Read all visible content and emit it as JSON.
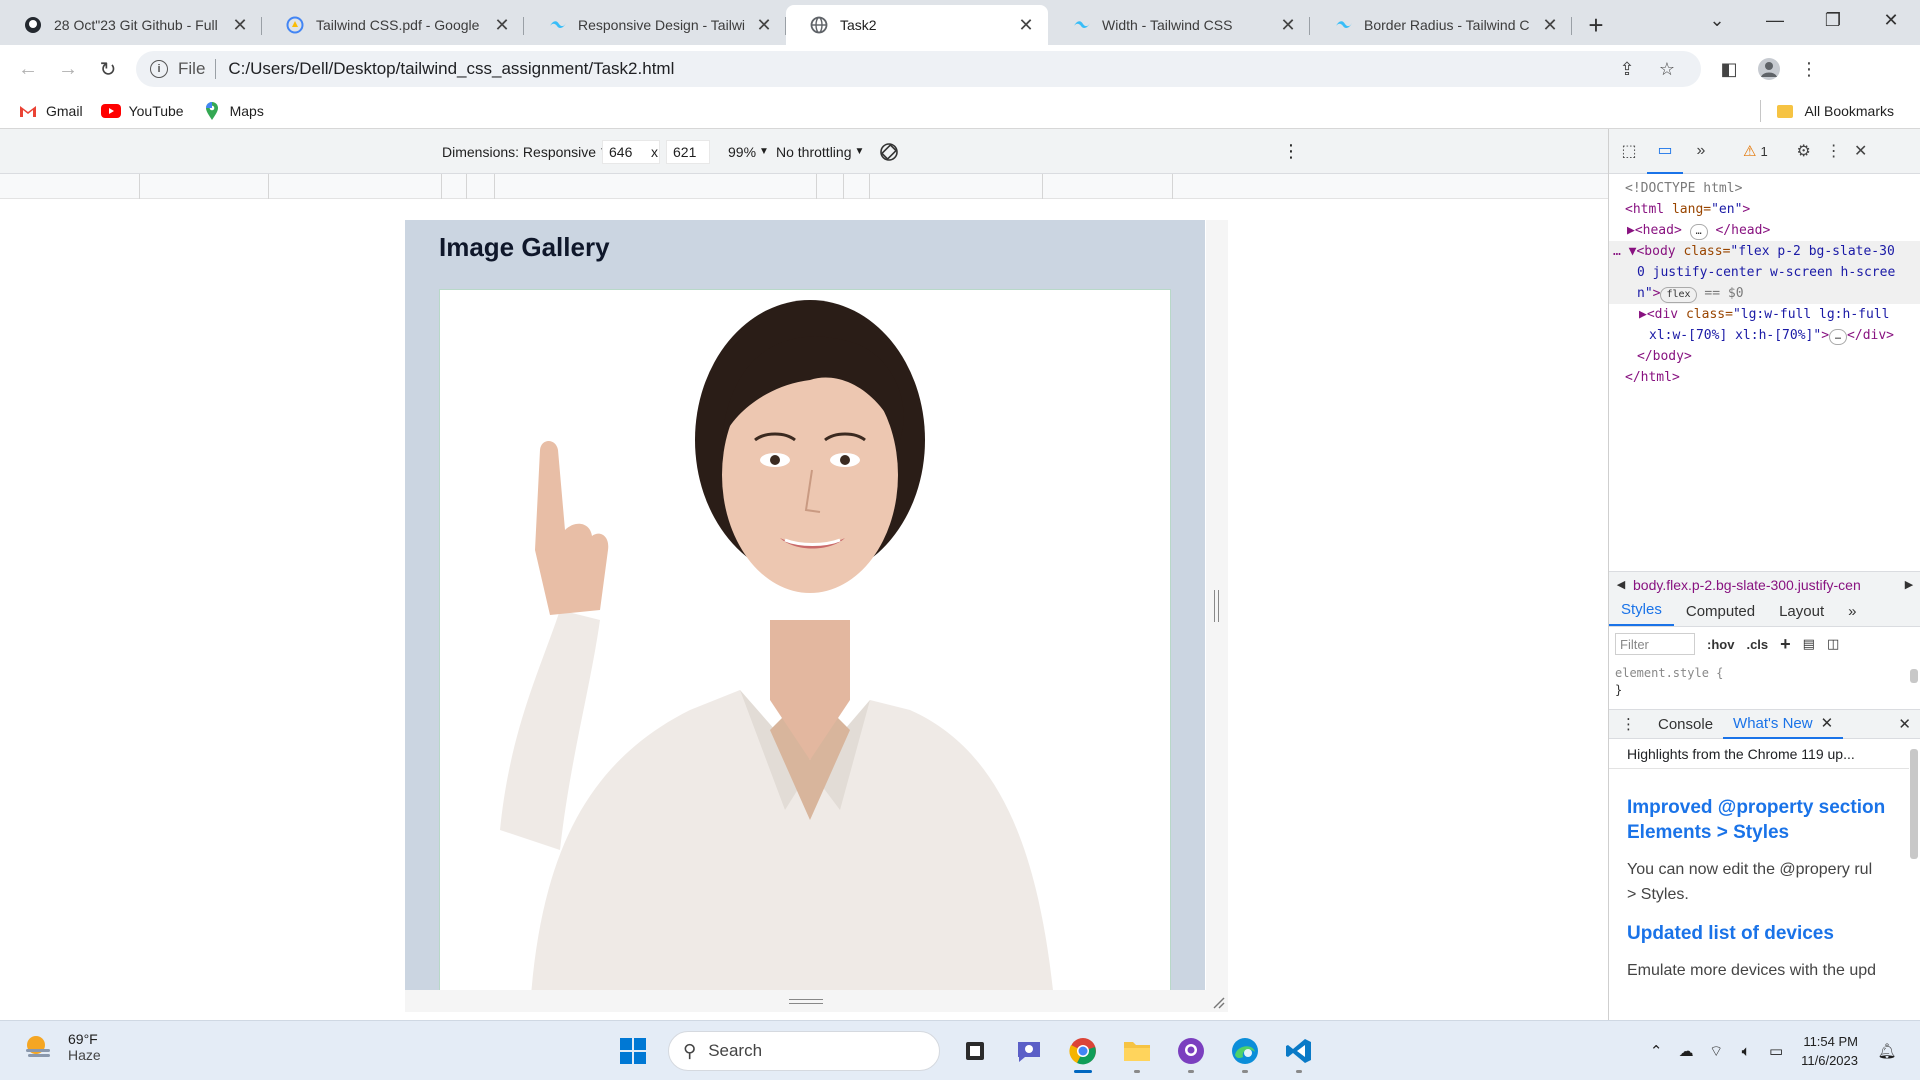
{
  "browser": {
    "tabs": [
      {
        "title": "28 Oct\"23 Git Github - Full",
        "icon": "github-icon",
        "active": false
      },
      {
        "title": "Tailwind CSS.pdf - Google",
        "icon": "google-drive-icon",
        "active": false
      },
      {
        "title": "Responsive Design - Tailwi",
        "icon": "tailwind-icon",
        "active": false
      },
      {
        "title": "Task2",
        "icon": "globe-icon",
        "active": true
      },
      {
        "title": "Width - Tailwind CSS",
        "icon": "tailwind-icon",
        "active": false
      },
      {
        "title": "Border Radius - Tailwind C",
        "icon": "tailwind-icon",
        "active": false
      }
    ],
    "address": {
      "scheme": "File",
      "url": "C:/Users/Dell/Desktop/tailwind_css_assignment/Task2.html"
    },
    "bookmarks": [
      {
        "label": "Gmail",
        "icon": "gmail-icon"
      },
      {
        "label": "YouTube",
        "icon": "youtube-icon"
      },
      {
        "label": "Maps",
        "icon": "maps-icon"
      }
    ],
    "all_bookmarks": "All Bookmarks"
  },
  "device_toolbar": {
    "dimensions_label": "Dimensions: Responsive",
    "width": "646",
    "times": "x",
    "height": "621",
    "zoom": "99%",
    "throttling": "No throttling"
  },
  "page": {
    "title": "Image Gallery",
    "bg_color": "#cbd5e1"
  },
  "devtools": {
    "warnings": "1",
    "elements": {
      "doctype": "<!DOCTYPE html>",
      "html_open_tag": "<html",
      "html_lang_attr": " lang=",
      "html_lang_val": "\"en\"",
      "head_line": "<head>",
      "head_close": "</head>",
      "body_tag": "<body",
      "body_class_attr": " class=",
      "body_class_line1": "\"flex p-2 bg-slate-30",
      "body_class_line2": "0 justify-center w-screen h-scree",
      "body_class_line3": "n\"",
      "flex_badge": "flex",
      "dollar0": "== $0",
      "div_tag": "<div",
      "div_class_attr": " class=",
      "div_class_line1": "\"lg:w-full lg:h-full",
      "div_class_line2": "xl:w-[70%] xl:h-[70%]\"",
      "div_close": "</div>",
      "body_close": "</body>",
      "html_close": "</html>"
    },
    "breadcrumb": "body.flex.p-2.bg-slate-300.justify-cen",
    "style_tabs": [
      "Styles",
      "Computed",
      "Layout"
    ],
    "filter_placeholder": "Filter",
    "hov": ":hov",
    "cls": ".cls",
    "element_style": "element.style {",
    "element_style_close": "}",
    "drawer_tabs": [
      "Console",
      "What's New"
    ],
    "whats_new": {
      "highlights": "Highlights from the Chrome 119 up...",
      "h1_line1": "Improved @property section",
      "h1_line2": "Elements > Styles",
      "p1_line1": "You can now edit the @propery rul",
      "p1_line2": "> Styles.",
      "h2": "Updated list of devices",
      "p2": "Emulate more devices with the upd"
    }
  },
  "taskbar": {
    "temperature": "69°F",
    "weather": "Haze",
    "search": "Search",
    "time": "11:54 PM",
    "date": "11/6/2023"
  }
}
